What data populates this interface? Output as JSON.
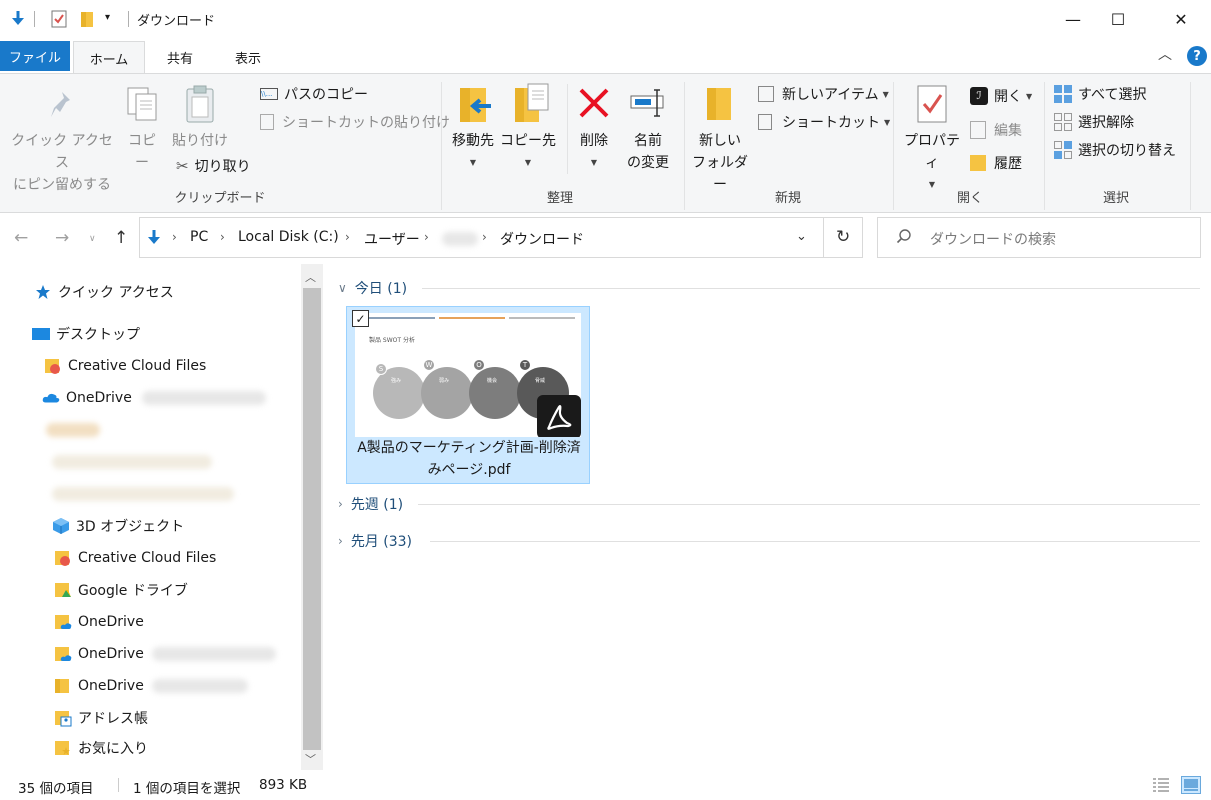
{
  "window": {
    "title": "ダウンロード",
    "minimize": "—",
    "maximize": "☐",
    "close": "✕"
  },
  "tabs": {
    "file": "ファイル",
    "home": "ホーム",
    "share": "共有",
    "view": "表示"
  },
  "ribbon": {
    "clipboard": {
      "pin_line1": "クイック アクセス",
      "pin_line2": "にピン留めする",
      "copy": "コピー",
      "paste": "貼り付け",
      "copy_path": "パスのコピー",
      "paste_shortcut": "ショートカットの貼り付け",
      "cut": "切り取り",
      "label": "クリップボード"
    },
    "organize": {
      "move_to": "移動先",
      "copy_to": "コピー先",
      "delete": "削除",
      "rename_line1": "名前",
      "rename_line2": "の変更",
      "label": "整理"
    },
    "new": {
      "new_folder_line1": "新しい",
      "new_folder_line2": "フォルダー",
      "new_item": "新しいアイテム",
      "shortcut": "ショートカット",
      "label": "新規"
    },
    "open": {
      "properties": "プロパティ",
      "open": "開く",
      "edit": "編集",
      "history": "履歴",
      "label": "開く"
    },
    "select": {
      "select_all": "すべて選択",
      "select_none": "選択解除",
      "invert": "選択の切り替え",
      "label": "選択"
    }
  },
  "address": {
    "crumbs": [
      "PC",
      "Local Disk (C:)",
      "ユーザー",
      "ダウンロード"
    ],
    "search_placeholder": "ダウンロードの検索"
  },
  "nav": {
    "quick_access": "クイック アクセス",
    "desktop": "デスクトップ",
    "creative_cloud_1": "Creative Cloud Files",
    "onedrive_1": "OneDrive",
    "objects_3d": "3D オブジェクト",
    "creative_cloud_2": "Creative Cloud Files",
    "google_drive": "Google ドライブ",
    "onedrive_2": "OneDrive",
    "onedrive_3": "OneDrive",
    "onedrive_4": "OneDrive",
    "address_book": "アドレス帳",
    "favorites": "お気に入り"
  },
  "content": {
    "groups": [
      {
        "label": "今日 (1)"
      },
      {
        "label": "先週 (1)"
      },
      {
        "label": "先月 (33)"
      }
    ],
    "file": {
      "name_line1": "A製品のマーケティング計画-削除済",
      "name_line2": "みページ.pdf",
      "thumb_title": "製品 SWOT 分析",
      "thumb_letters": [
        "S",
        "W",
        "O",
        "T"
      ],
      "thumb_headings": [
        "強み",
        "弱み",
        "機会",
        "脅威"
      ]
    }
  },
  "status": {
    "count": "35 個の項目",
    "selected": "1 個の項目を選択",
    "size": "893 KB"
  },
  "colors": {
    "accent": "#1979ca",
    "selection": "#cce8ff",
    "group_header": "#1f4e79"
  }
}
